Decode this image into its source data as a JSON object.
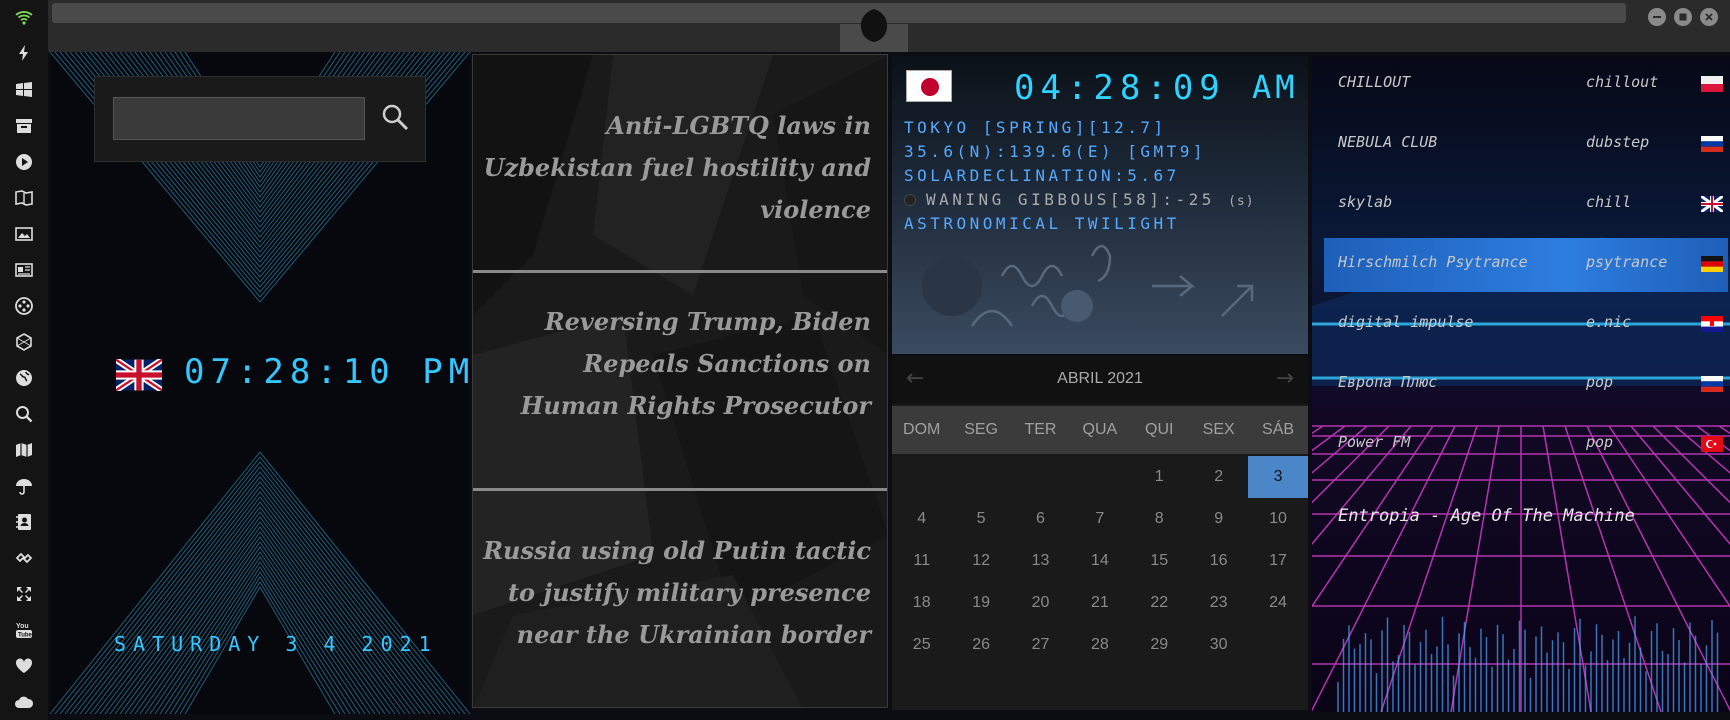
{
  "sidebar": {
    "icons": [
      "wifi-icon",
      "lightning-icon",
      "windows-icon",
      "archive-icon",
      "play-icon",
      "book-icon",
      "image-icon",
      "news-icon",
      "film-reel-icon",
      "hexagon-icon",
      "globe-icon",
      "search-icon",
      "map-icon",
      "umbrella-icon",
      "contacts-icon",
      "link-icon",
      "fullscreen-icon",
      "youtube-icon",
      "heart-icon",
      "cloud-icon"
    ]
  },
  "search": {
    "value": "",
    "placeholder": ""
  },
  "clock_uk": {
    "time": "07:28:10 PM",
    "date": "SATURDAY 3 4 2021"
  },
  "news": [
    {
      "headline": "Anti-LGBTQ laws in Uzbekistan fuel hostility and violence"
    },
    {
      "headline": "Reversing Trump, Biden Repeals Sanctions on Human Rights Prosecutor"
    },
    {
      "headline": "Russia using old Putin tactic to justify military presence near the Ukrainian border"
    }
  ],
  "tokyo": {
    "time": "04:28:09",
    "ampm": "AM",
    "line1": "TOKYO [SPRING][12.7]",
    "line2": "35.6(N):139.6(E) [GMT9]",
    "line3": "SOLARDECLINATION:5.67",
    "moon": "WANING GIBBOUS[58]:-25",
    "moon_unit": "(s)",
    "twilight": "ASTRONOMICAL TWILIGHT"
  },
  "calendar": {
    "prev": "←",
    "next": "→",
    "month": "ABRIL 2021",
    "weekdays": [
      "DOM",
      "SEG",
      "TER",
      "QUA",
      "QUI",
      "SEX",
      "SÁB"
    ],
    "weeks": [
      [
        "",
        "",
        "",
        "",
        "1",
        "2",
        "3"
      ],
      [
        "4",
        "5",
        "6",
        "7",
        "8",
        "9",
        "10"
      ],
      [
        "11",
        "12",
        "13",
        "14",
        "15",
        "16",
        "17"
      ],
      [
        "18",
        "19",
        "20",
        "21",
        "22",
        "23",
        "24"
      ],
      [
        "25",
        "26",
        "27",
        "28",
        "29",
        "30",
        ""
      ]
    ],
    "today": "3"
  },
  "radio": {
    "stations": [
      {
        "name": "CHILLOUT",
        "genre": "chillout",
        "flag": "poland"
      },
      {
        "name": "NEBULA CLUB",
        "genre": "dubstep",
        "flag": "russia"
      },
      {
        "name": "skylab",
        "genre": "chill",
        "flag": "uk"
      },
      {
        "name": "Hirschmilch Psytrance",
        "genre": "psytrance",
        "flag": "germany"
      },
      {
        "name": "digital impulse",
        "genre": "e.nic",
        "flag": "croatia"
      },
      {
        "name": "Европа Плюс",
        "genre": "pop",
        "flag": "russia"
      },
      {
        "name": "Power FM",
        "genre": "pop",
        "flag": "turkey"
      }
    ],
    "active_index": 3,
    "now_playing": "Entropia - Age Of The Machine"
  },
  "colors": {
    "accent_cyan": "#35c7ff",
    "accent_blue": "#55aaff",
    "calendar_today": "#4a86c8",
    "radio_active": "#2d7de0"
  }
}
